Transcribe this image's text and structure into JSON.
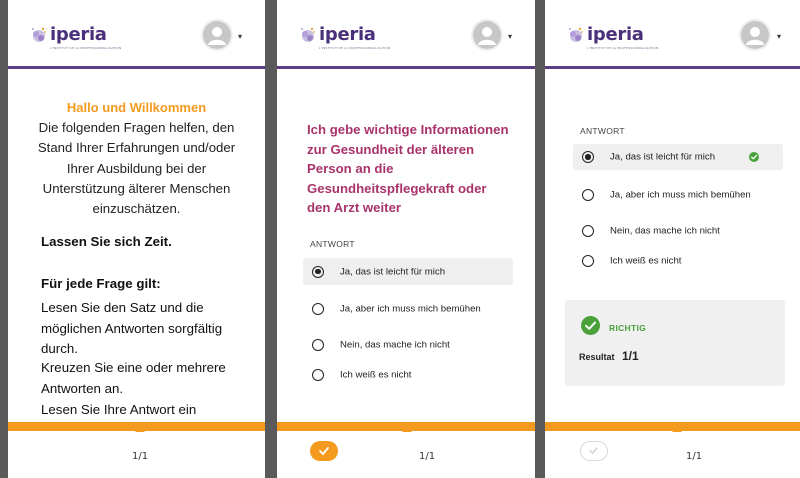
{
  "brand": {
    "logo_text": "iperia",
    "logo_tagline": "L'INSTITUT DE LA PROFESSIONNALISATION"
  },
  "header": {
    "account_caret": "▾"
  },
  "intro": {
    "title": "Hallo und Willkommen",
    "body": "Die folgenden Fragen helfen, den Stand Ihrer Erfahrungen und/oder Ihrer Ausbildung bei der Unterstützung älterer Menschen einzuschätzen.",
    "take_time": "Lassen Sie sich Zeit.",
    "rule_heading": "Für jede Frage gilt:",
    "para1": "Lesen Sie den Satz und die möglichen Antworten sorgfältig durch.",
    "para2": "Kreuzen Sie eine oder mehrere Antworten an.",
    "para3": "Lesen Sie Ihre Antwort ein"
  },
  "question": {
    "text": "Ich gebe wichtige Informationen zur Gesundheit der älteren Person an die Gesundheitspflegekraft oder den Arzt weiter",
    "answer_label": "ANTWORT",
    "options": [
      {
        "label": "Ja, das ist leicht für mich",
        "selected": true
      },
      {
        "label": "Ja, aber ich muss mich bemühen",
        "selected": false
      },
      {
        "label": "Nein, das mache ich nicht",
        "selected": false
      },
      {
        "label": "Ich weiß es nicht",
        "selected": false
      }
    ]
  },
  "result": {
    "status": "RICHTIG",
    "label": "Resultat",
    "value": "1/1"
  },
  "footer": {
    "pager": "1/1"
  },
  "colors": {
    "accent": "#f39a1f",
    "brand": "#5b3d86",
    "question": "#a8336a",
    "correct": "#4aa13a"
  }
}
